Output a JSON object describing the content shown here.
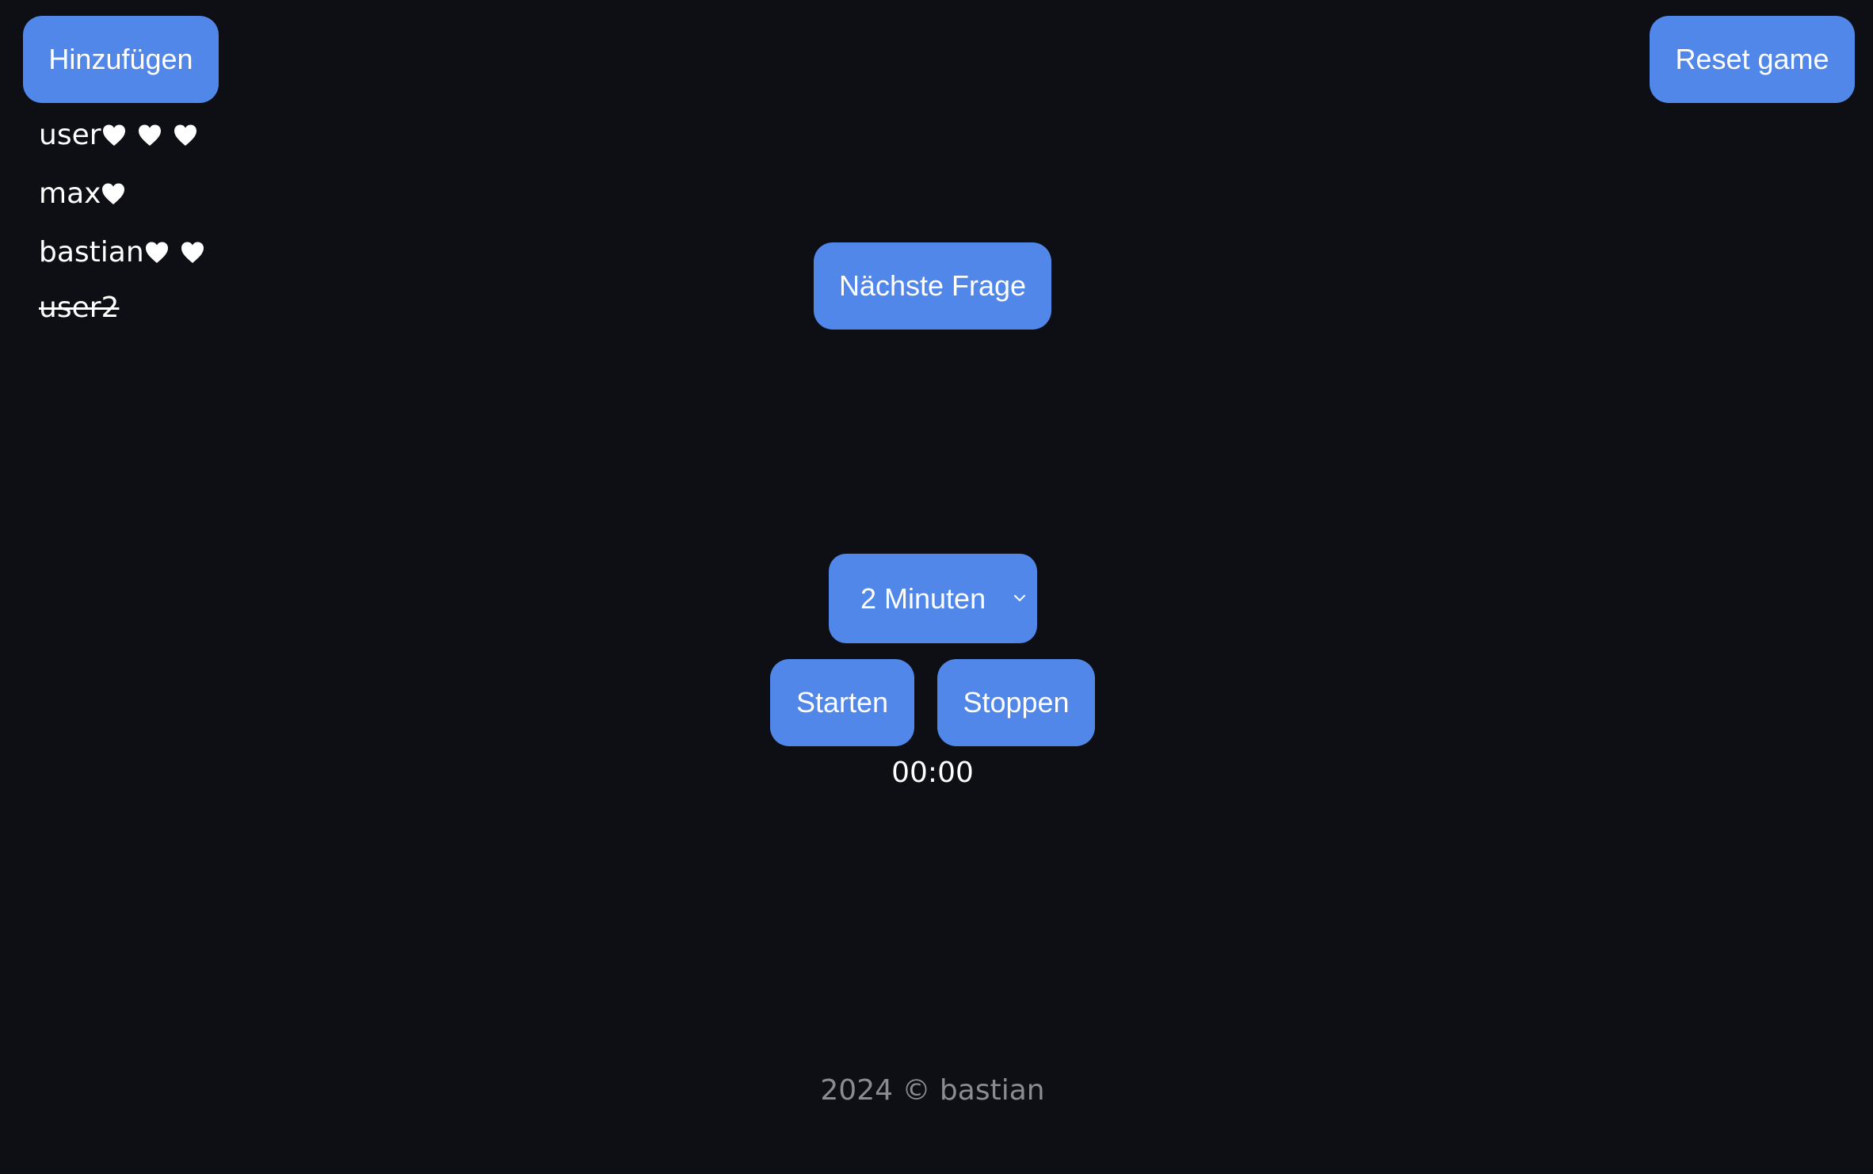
{
  "header": {
    "add_label": "Hinzufügen",
    "reset_label": "Reset game"
  },
  "players": [
    {
      "name": "user",
      "hearts": 3,
      "eliminated": false
    },
    {
      "name": "max",
      "hearts": 1,
      "eliminated": false
    },
    {
      "name": "bastian",
      "hearts": 2,
      "eliminated": false
    },
    {
      "name": "user2",
      "hearts": 0,
      "eliminated": true
    }
  ],
  "main": {
    "next_question_label": "Nächste Frage",
    "duration": {
      "selected": "2 Minuten"
    },
    "start_label": "Starten",
    "stop_label": "Stoppen",
    "timer": "00:00"
  },
  "footer": {
    "text": "2024 © bastian"
  },
  "icons": {
    "heart": "heart-icon",
    "dropdown": "chevron-down-icon"
  },
  "colors": {
    "background": "#0d0f15",
    "accent": "#5087e8",
    "text": "#ffffff",
    "muted": "#8a8c93"
  }
}
